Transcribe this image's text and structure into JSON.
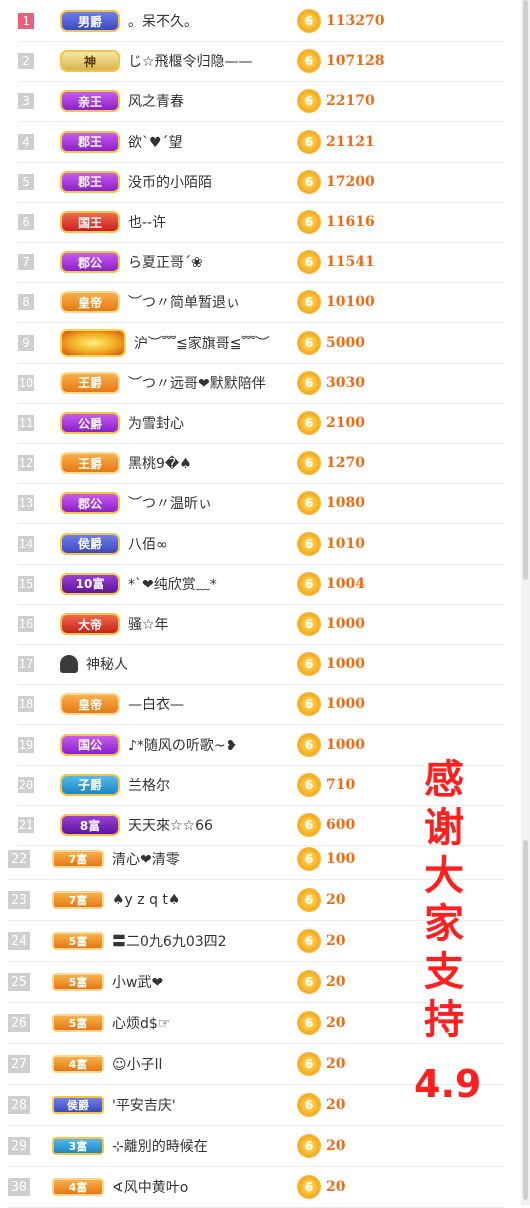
{
  "ranking": [
    {
      "rank": "1",
      "badge": "男爵",
      "badge_style": "blue",
      "name": "。呆不久。",
      "amount": "113270"
    },
    {
      "rank": "2",
      "badge": "神",
      "badge_style": "gold",
      "name": "じ☆飛椻令归隐——",
      "amount": "107128"
    },
    {
      "rank": "3",
      "badge": "亲王",
      "badge_style": "violet",
      "name": "风之青春",
      "amount": "22170"
    },
    {
      "rank": "4",
      "badge": "郡王",
      "badge_style": "violet",
      "name": "欲ˋ♥ˊ望",
      "amount": "21121"
    },
    {
      "rank": "5",
      "badge": "郡王",
      "badge_style": "violet",
      "name": "没币的小陌陌",
      "amount": "17200"
    },
    {
      "rank": "6",
      "badge": "国王",
      "badge_style": "red",
      "name": "也--许",
      "amount": "11616"
    },
    {
      "rank": "7",
      "badge": "郡公",
      "badge_style": "violet",
      "name": "ら夏正哥ˊ❀",
      "amount": "11541"
    },
    {
      "rank": "8",
      "badge": "皇帝",
      "badge_style": "orange",
      "name": "︶つ〃简单暂退ぃ",
      "amount": "10100"
    },
    {
      "rank": "9",
      "badge": "",
      "badge_style": "sun",
      "name": "沪︶﹌≦家旗哥≦﹌︶",
      "amount": "5000"
    },
    {
      "rank": "10",
      "badge": "王爵",
      "badge_style": "orange",
      "name": "︶つ〃远哥❤默默陪伴",
      "amount": "3030"
    },
    {
      "rank": "11",
      "badge": "公爵",
      "badge_style": "violet",
      "name": "为雪封心",
      "amount": "2100"
    },
    {
      "rank": "12",
      "badge": "王爵",
      "badge_style": "orange",
      "name": "黑桃9�♠",
      "amount": "1270"
    },
    {
      "rank": "13",
      "badge": "郡公",
      "badge_style": "violet",
      "name": "︶つ〃温昕ぃ",
      "amount": "1080"
    },
    {
      "rank": "14",
      "badge": "侯爵",
      "badge_style": "blue",
      "name": "八佰∞",
      "amount": "1010"
    },
    {
      "rank": "15",
      "badge": "10富",
      "badge_style": "deep",
      "name": "*ˋ❤纯欣赏﹏*",
      "amount": "1004"
    },
    {
      "rank": "16",
      "badge": "大帝",
      "badge_style": "red",
      "name": "骚☆年",
      "amount": "1000"
    },
    {
      "rank": "17",
      "badge": "",
      "badge_style": "mystery",
      "name": "神秘人",
      "amount": "1000"
    },
    {
      "rank": "18",
      "badge": "皇帝",
      "badge_style": "orange",
      "name": "—白衣—",
      "amount": "1000"
    },
    {
      "rank": "19",
      "badge": "国公",
      "badge_style": "violet",
      "name": "♪*随风の听歌~❥",
      "amount": "1000"
    },
    {
      "rank": "20",
      "badge": "子爵",
      "badge_style": "teal",
      "name": "兰格尔",
      "amount": "710"
    },
    {
      "rank": "21",
      "badge": "8富",
      "badge_style": "deep",
      "name": "天天來☆☆66",
      "amount": "600"
    },
    {
      "rank": "22",
      "badge": "7富",
      "badge_style": "orange",
      "name": "清心❤清零",
      "amount": "100"
    },
    {
      "rank": "23",
      "badge": "7富",
      "badge_style": "orange",
      "name": "♠y z q t♠",
      "amount": "20"
    },
    {
      "rank": "24",
      "badge": "5富",
      "badge_style": "orange",
      "name": "〓二0九6九03四2",
      "amount": "20"
    },
    {
      "rank": "25",
      "badge": "5富",
      "badge_style": "orange",
      "name": "小w武❤",
      "amount": "20"
    },
    {
      "rank": "26",
      "badge": "5富",
      "badge_style": "orange",
      "name": "心烦d$☞",
      "amount": "20"
    },
    {
      "rank": "27",
      "badge": "4富",
      "badge_style": "orange",
      "name": "☺小子ll",
      "amount": "20"
    },
    {
      "rank": "28",
      "badge": "侯爵",
      "badge_style": "blue",
      "name": "'平安吉庆'",
      "amount": "20"
    },
    {
      "rank": "29",
      "badge": "3富",
      "badge_style": "teal",
      "name": "⊹離別的時候在",
      "amount": "20"
    },
    {
      "rank": "30",
      "badge": "4富",
      "badge_style": "orange",
      "name": "∢风中黄叶o",
      "amount": "20"
    }
  ],
  "coin_label": "6",
  "overlay": {
    "chars": [
      "感",
      "谢",
      "大",
      "家",
      "支",
      "持"
    ],
    "number": "4.9"
  },
  "colors": {
    "amount": "#f06a14",
    "overlay": "#ff1f1f",
    "rank_top": "#e8607a"
  }
}
